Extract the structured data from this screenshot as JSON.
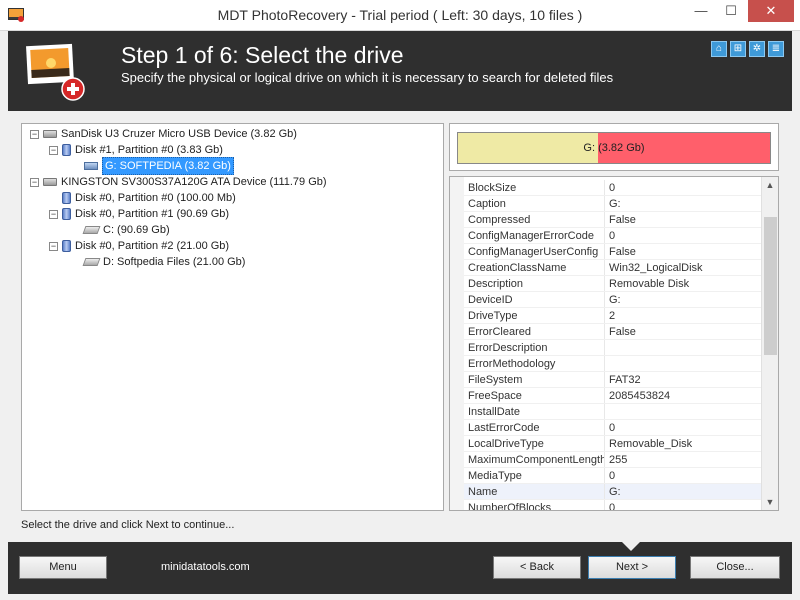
{
  "window": {
    "title": "MDT PhotoRecovery - Trial period ( Left: 30 days, 10 files )",
    "min_glyph": "—",
    "max_glyph": "☐",
    "close_glyph": "✕"
  },
  "header": {
    "step_title": "Step 1 of 6: Select the drive",
    "step_subtitle": "Specify the physical or logical drive on which it is necessary to search for deleted files",
    "icons": [
      "home-icon",
      "network-icon",
      "settings-icon",
      "info-icon"
    ],
    "icon_glyphs": [
      "⌂",
      "⊞",
      "✲",
      "≣"
    ]
  },
  "tree": {
    "nodes": [
      {
        "label": "SanDisk U3 Cruzer Micro USB Device (3.82 Gb)",
        "expander": "−",
        "icon": "drive-icon"
      },
      {
        "label": "Disk #1, Partition #0 (3.83 Gb)",
        "expander": "−",
        "icon": "disk-icon"
      },
      {
        "label": "G: SOFTPEDIA (3.82 Gb)",
        "icon": "usb-volume-icon",
        "selected": true
      },
      {
        "label": "KINGSTON SV300S37A120G ATA Device (111.79 Gb)",
        "expander": "−",
        "icon": "drive-icon"
      },
      {
        "label": "Disk #0, Partition #0 (100.00 Mb)",
        "icon": "disk-icon"
      },
      {
        "label": "Disk #0, Partition #1 (90.69 Gb)",
        "expander": "−",
        "icon": "disk-icon"
      },
      {
        "label": "C:  (90.69 Gb)",
        "icon": "volume-icon"
      },
      {
        "label": "Disk #0, Partition #2 (21.00 Gb)",
        "expander": "−",
        "icon": "disk-icon"
      },
      {
        "label": "D: Softpedia Files (21.00 Gb)",
        "icon": "volume-icon"
      }
    ]
  },
  "usage_bar": {
    "label": "G: (3.82 Gb)",
    "used_fraction": 0.45,
    "used_color": "#efeaa5",
    "free_color": "#ff5f6b"
  },
  "properties": {
    "rows": [
      {
        "name": "BlockSize",
        "value": "0"
      },
      {
        "name": "Caption",
        "value": "G:"
      },
      {
        "name": "Compressed",
        "value": "False"
      },
      {
        "name": "ConfigManagerErrorCode",
        "value": "0"
      },
      {
        "name": "ConfigManagerUserConfig",
        "value": "False"
      },
      {
        "name": "CreationClassName",
        "value": "Win32_LogicalDisk"
      },
      {
        "name": "Description",
        "value": "Removable Disk"
      },
      {
        "name": "DeviceID",
        "value": "G:"
      },
      {
        "name": "DriveType",
        "value": "2"
      },
      {
        "name": "ErrorCleared",
        "value": "False"
      },
      {
        "name": "ErrorDescription",
        "value": ""
      },
      {
        "name": "ErrorMethodology",
        "value": ""
      },
      {
        "name": "FileSystem",
        "value": "FAT32"
      },
      {
        "name": "FreeSpace",
        "value": "2085453824"
      },
      {
        "name": "InstallDate",
        "value": ""
      },
      {
        "name": "LastErrorCode",
        "value": "0"
      },
      {
        "name": "LocalDriveType",
        "value": "Removable_Disk"
      },
      {
        "name": "MaximumComponentLength",
        "value": "255"
      },
      {
        "name": "MediaType",
        "value": "0"
      },
      {
        "name": "Name",
        "value": "G:",
        "highlighted": true
      },
      {
        "name": "NumberOfBlocks",
        "value": "0"
      }
    ]
  },
  "status_text": "Select the drive and click Next to continue...",
  "footer": {
    "menu_label": "Menu",
    "site_text": "minidatatools.com",
    "back_label": "< Back",
    "next_label": "Next >",
    "close_label": "Close..."
  },
  "scrollbar": {
    "up_glyph": "▲",
    "down_glyph": "▼"
  }
}
